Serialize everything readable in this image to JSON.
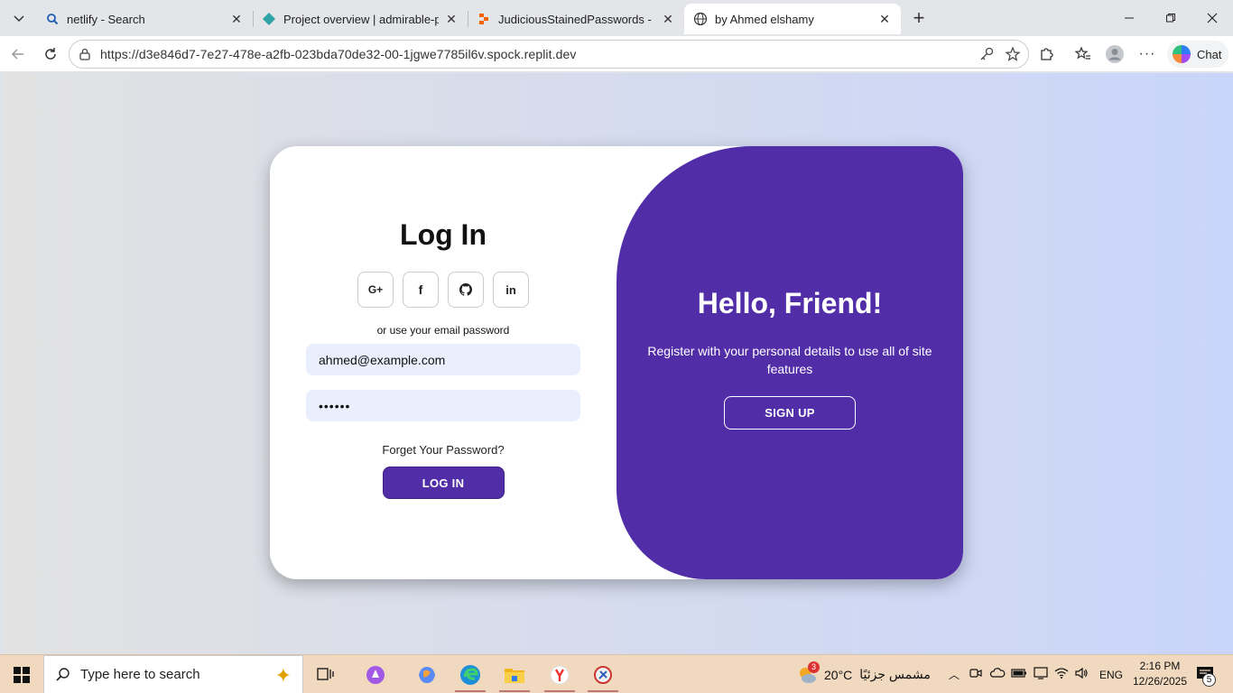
{
  "browser": {
    "tabs": [
      {
        "title": "netlify - Search",
        "icon": "search-icon"
      },
      {
        "title": "Project overview | admirable-pasca",
        "icon": "netlify-icon"
      },
      {
        "title": "JudiciousStainedPasswords - Replit",
        "icon": "replit-icon"
      },
      {
        "title": "by Ahmed elshamy",
        "icon": "globe-icon",
        "active": true
      }
    ],
    "url": "https://d3e846d7-7e27-478e-a2fb-023bda70de32-00-1jgwe7785il6v.spock.replit.dev",
    "chat_label": "Chat"
  },
  "login": {
    "title": "Log In",
    "socials": [
      {
        "name": "google",
        "glyph": "G+"
      },
      {
        "name": "facebook",
        "glyph": "f"
      },
      {
        "name": "github",
        "glyph": "github"
      },
      {
        "name": "linkedin",
        "glyph": "in"
      }
    ],
    "hint": "or use your email password",
    "email_value": "ahmed@example.com",
    "password_value": "••••••",
    "forgot": "Forget Your Password?",
    "button": "LOG IN"
  },
  "toggle": {
    "title": "Hello, Friend!",
    "text": "Register with your personal details to use all of site features",
    "button": "SIGN UP"
  },
  "colors": {
    "accent": "#512da8",
    "field_bg": "#eaeffd",
    "taskbar": "#f0d9bf"
  },
  "taskbar": {
    "search_placeholder": "Type here to search",
    "weather_temp": "20°C",
    "weather_text": "مشمس جزئيًا",
    "weather_badge": "3",
    "language": "ENG",
    "time": "2:16 PM",
    "date": "12/26/2025",
    "notification_count": "5"
  }
}
